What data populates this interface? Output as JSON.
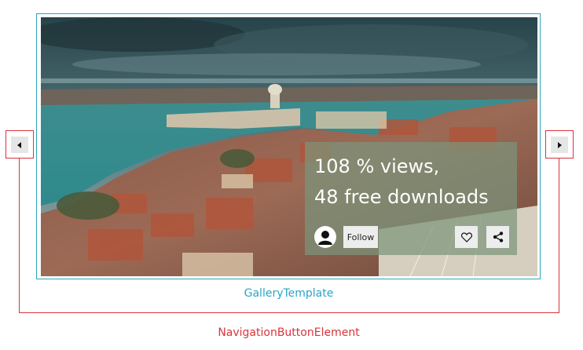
{
  "gallery": {
    "stats_views": "108 % views,",
    "stats_downloads": "48 free downloads",
    "follow_label": "Follow",
    "icons": {
      "avatar": "user-avatar-icon",
      "like": "heart-icon",
      "share": "share-icon",
      "prev": "arrow-left-icon",
      "next": "arrow-right-icon"
    }
  },
  "labels": {
    "gallery_template": "GalleryTemplate",
    "navigation_button_element": "NavigationButtonElement"
  },
  "colors": {
    "gallery_template_label": "#2aa5c8",
    "navigation_label": "#d9343b",
    "gallery_frame": "#2aa5b8",
    "overlay": "#7c947c"
  }
}
